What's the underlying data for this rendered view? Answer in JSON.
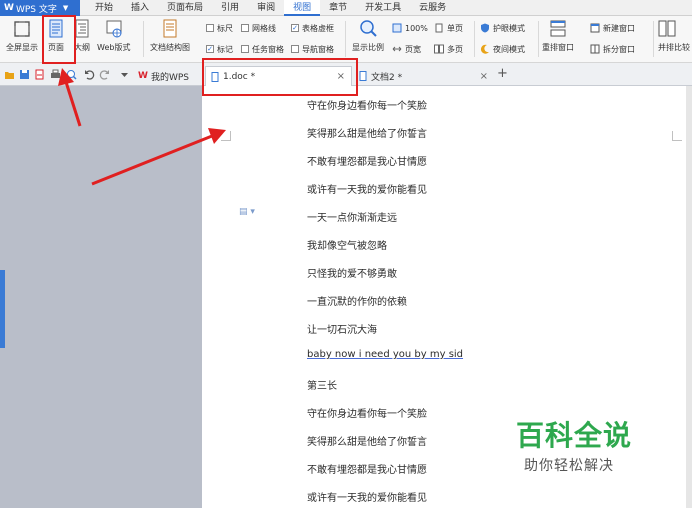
{
  "menubar": {
    "app_name": "WPS 文字",
    "tabs": [
      "开始",
      "插入",
      "页面布局",
      "引用",
      "审阅",
      "视图",
      "章节",
      "开发工具",
      "云服务"
    ],
    "active_tab": "视图"
  },
  "ribbon": {
    "fullscreen": "全屏显示",
    "page_view": "页面",
    "outline": "大纲",
    "web_layout": "Web版式",
    "doc_map": "文档结构图",
    "ruler": "标尺",
    "gridlines": "网格线",
    "table_gridlines": "表格虚框",
    "markup": "标记",
    "task_pane": "任务窗格",
    "nav_pane": "导航窗格",
    "zoom": "显示比例",
    "zoom_100": "100%",
    "page_width": "页宽",
    "single_page": "单页",
    "multi_page": "多页",
    "eye_mode": "护眼模式",
    "night_mode": "夜间模式",
    "rearrange": "重排窗口",
    "new_window": "新建窗口",
    "split_window": "拆分窗口",
    "side_by_side": "并排比较"
  },
  "doc_tabs": {
    "home": "我的WPS",
    "doc1": "1.doc *",
    "doc2": "文档2 *",
    "close": "×",
    "add": "+"
  },
  "document": {
    "lines": [
      "守在你身边看你每一个笑脸",
      "笑得那么甜是他给了你誓言",
      "不敢有埋怨都是我心甘情愿",
      "或许有一天我的爱你能看见",
      "一天一点你渐渐走远",
      "我却像空气被忽略",
      "只怪我的爱不够勇敢",
      "一直沉默的作你的依赖",
      "让一切石沉大海",
      "baby now i need you by my sid",
      "第三长",
      "守在你身边看你每一个笑脸",
      "笑得那么甜是他给了你誓言",
      "不敢有埋怨都是我心甘情愿",
      "或许有一天我的爱你能看见"
    ]
  },
  "watermark": {
    "main": "百科全说",
    "sub": "助你轻松解决"
  },
  "colors": {
    "accent": "#2f6fd0",
    "highlight": "#e02020",
    "watermark": "#2ea84e"
  }
}
